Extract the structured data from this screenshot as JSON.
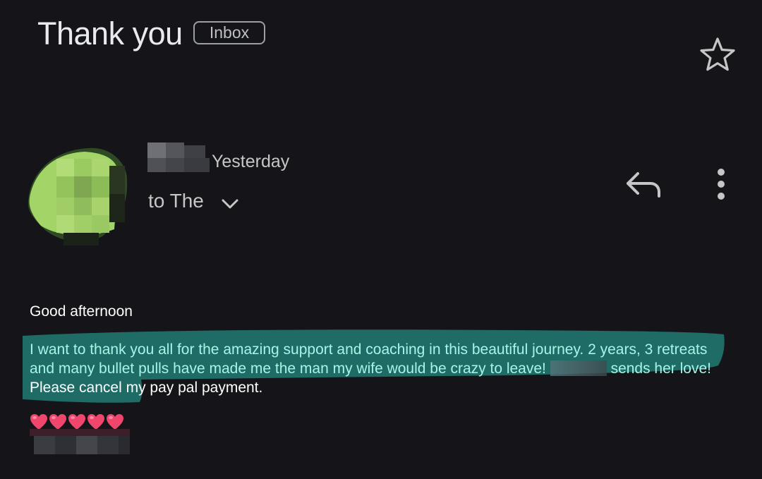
{
  "header": {
    "subject": "Thank you",
    "label": "Inbox"
  },
  "sender": {
    "date": "Yesterday",
    "recipients_text": "to The"
  },
  "icons": {
    "star": "star-outline-icon",
    "reply": "reply-icon",
    "more": "more-vert-icon",
    "expand": "chevron-down-icon",
    "heart": "red-heart-emoji"
  },
  "message": {
    "greeting": "Good afternoon",
    "highlighted_text": "I want to thank you all for the amazing support and coaching in this beautiful journey. 2 years, 3 retreats and many bullet pulls have made me the man my wife would be crazy to leave!",
    "highlighted_text_2": "sends her love!",
    "plain_text": " Please cancel my pay pal payment.",
    "hearts": "❤️❤️❤️❤️❤️",
    "heart_count": 5
  },
  "colors": {
    "background": "#141419",
    "highlight": "#1f6b66",
    "highlight_text": "#a6f5e8",
    "avatar": "#a3d468"
  }
}
